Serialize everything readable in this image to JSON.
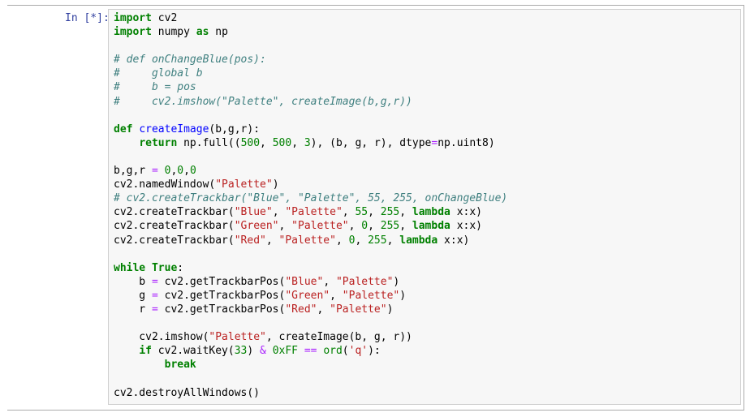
{
  "cell": {
    "prompt": "In [*]:",
    "lines": [
      [
        {
          "t": "import",
          "c": "kw"
        },
        {
          "t": " cv2"
        }
      ],
      [
        {
          "t": "import",
          "c": "kw"
        },
        {
          "t": " numpy "
        },
        {
          "t": "as",
          "c": "kw"
        },
        {
          "t": " np"
        }
      ],
      [],
      [
        {
          "t": "# def onChangeBlue(pos):",
          "c": "cm"
        }
      ],
      [
        {
          "t": "#     global b",
          "c": "cm"
        }
      ],
      [
        {
          "t": "#     b = pos",
          "c": "cm"
        }
      ],
      [
        {
          "t": "#     cv2.imshow(\"Palette\", createImage(b,g,r))",
          "c": "cm"
        }
      ],
      [],
      [
        {
          "t": "def",
          "c": "kw"
        },
        {
          "t": " "
        },
        {
          "t": "createImage",
          "c": "fn"
        },
        {
          "t": "(b,g,r):"
        }
      ],
      [
        {
          "t": "    "
        },
        {
          "t": "return",
          "c": "kw"
        },
        {
          "t": " np.full(("
        },
        {
          "t": "500",
          "c": "num"
        },
        {
          "t": ", "
        },
        {
          "t": "500",
          "c": "num"
        },
        {
          "t": ", "
        },
        {
          "t": "3",
          "c": "num"
        },
        {
          "t": "), (b, g, r), dtype"
        },
        {
          "t": "=",
          "c": "op"
        },
        {
          "t": "np.uint8)"
        }
      ],
      [],
      [
        {
          "t": "b,g,r "
        },
        {
          "t": "=",
          "c": "op"
        },
        {
          "t": " "
        },
        {
          "t": "0",
          "c": "num"
        },
        {
          "t": ","
        },
        {
          "t": "0",
          "c": "num"
        },
        {
          "t": ","
        },
        {
          "t": "0",
          "c": "num"
        }
      ],
      [
        {
          "t": "cv2.namedWindow("
        },
        {
          "t": "\"Palette\"",
          "c": "st"
        },
        {
          "t": ")"
        }
      ],
      [
        {
          "t": "# cv2.createTrackbar(\"Blue\", \"Palette\", 55, 255, onChangeBlue)",
          "c": "cm"
        }
      ],
      [
        {
          "t": "cv2.createTrackbar("
        },
        {
          "t": "\"Blue\"",
          "c": "st"
        },
        {
          "t": ", "
        },
        {
          "t": "\"Palette\"",
          "c": "st"
        },
        {
          "t": ", "
        },
        {
          "t": "55",
          "c": "num"
        },
        {
          "t": ", "
        },
        {
          "t": "255",
          "c": "num"
        },
        {
          "t": ", "
        },
        {
          "t": "lambda",
          "c": "kw"
        },
        {
          "t": " x:x)"
        }
      ],
      [
        {
          "t": "cv2.createTrackbar("
        },
        {
          "t": "\"Green\"",
          "c": "st"
        },
        {
          "t": ", "
        },
        {
          "t": "\"Palette\"",
          "c": "st"
        },
        {
          "t": ", "
        },
        {
          "t": "0",
          "c": "num"
        },
        {
          "t": ", "
        },
        {
          "t": "255",
          "c": "num"
        },
        {
          "t": ", "
        },
        {
          "t": "lambda",
          "c": "kw"
        },
        {
          "t": " x:x)"
        }
      ],
      [
        {
          "t": "cv2.createTrackbar("
        },
        {
          "t": "\"Red\"",
          "c": "st"
        },
        {
          "t": ", "
        },
        {
          "t": "\"Palette\"",
          "c": "st"
        },
        {
          "t": ", "
        },
        {
          "t": "0",
          "c": "num"
        },
        {
          "t": ", "
        },
        {
          "t": "255",
          "c": "num"
        },
        {
          "t": ", "
        },
        {
          "t": "lambda",
          "c": "kw"
        },
        {
          "t": " x:x)"
        }
      ],
      [],
      [
        {
          "t": "while",
          "c": "kw"
        },
        {
          "t": " "
        },
        {
          "t": "True",
          "c": "kw"
        },
        {
          "t": ":"
        }
      ],
      [
        {
          "t": "    b "
        },
        {
          "t": "=",
          "c": "op"
        },
        {
          "t": " cv2.getTrackbarPos("
        },
        {
          "t": "\"Blue\"",
          "c": "st"
        },
        {
          "t": ", "
        },
        {
          "t": "\"Palette\"",
          "c": "st"
        },
        {
          "t": ")"
        }
      ],
      [
        {
          "t": "    g "
        },
        {
          "t": "=",
          "c": "op"
        },
        {
          "t": " cv2.getTrackbarPos("
        },
        {
          "t": "\"Green\"",
          "c": "st"
        },
        {
          "t": ", "
        },
        {
          "t": "\"Palette\"",
          "c": "st"
        },
        {
          "t": ")"
        }
      ],
      [
        {
          "t": "    r "
        },
        {
          "t": "=",
          "c": "op"
        },
        {
          "t": " cv2.getTrackbarPos("
        },
        {
          "t": "\"Red\"",
          "c": "st"
        },
        {
          "t": ", "
        },
        {
          "t": "\"Palette\"",
          "c": "st"
        },
        {
          "t": ")"
        }
      ],
      [],
      [
        {
          "t": "    cv2.imshow("
        },
        {
          "t": "\"Palette\"",
          "c": "st"
        },
        {
          "t": ", createImage(b, g, r))"
        }
      ],
      [
        {
          "t": "    "
        },
        {
          "t": "if",
          "c": "kw"
        },
        {
          "t": " cv2.waitKey("
        },
        {
          "t": "33",
          "c": "num"
        },
        {
          "t": ") "
        },
        {
          "t": "&",
          "c": "op"
        },
        {
          "t": " "
        },
        {
          "t": "0xFF",
          "c": "num"
        },
        {
          "t": " "
        },
        {
          "t": "==",
          "c": "op"
        },
        {
          "t": " "
        },
        {
          "t": "ord",
          "c": "nb"
        },
        {
          "t": "("
        },
        {
          "t": "'q'",
          "c": "st"
        },
        {
          "t": "):"
        }
      ],
      [
        {
          "t": "        "
        },
        {
          "t": "break",
          "c": "kw"
        }
      ],
      [],
      [
        {
          "t": "cv2.destroyAllWindows()"
        }
      ]
    ]
  }
}
